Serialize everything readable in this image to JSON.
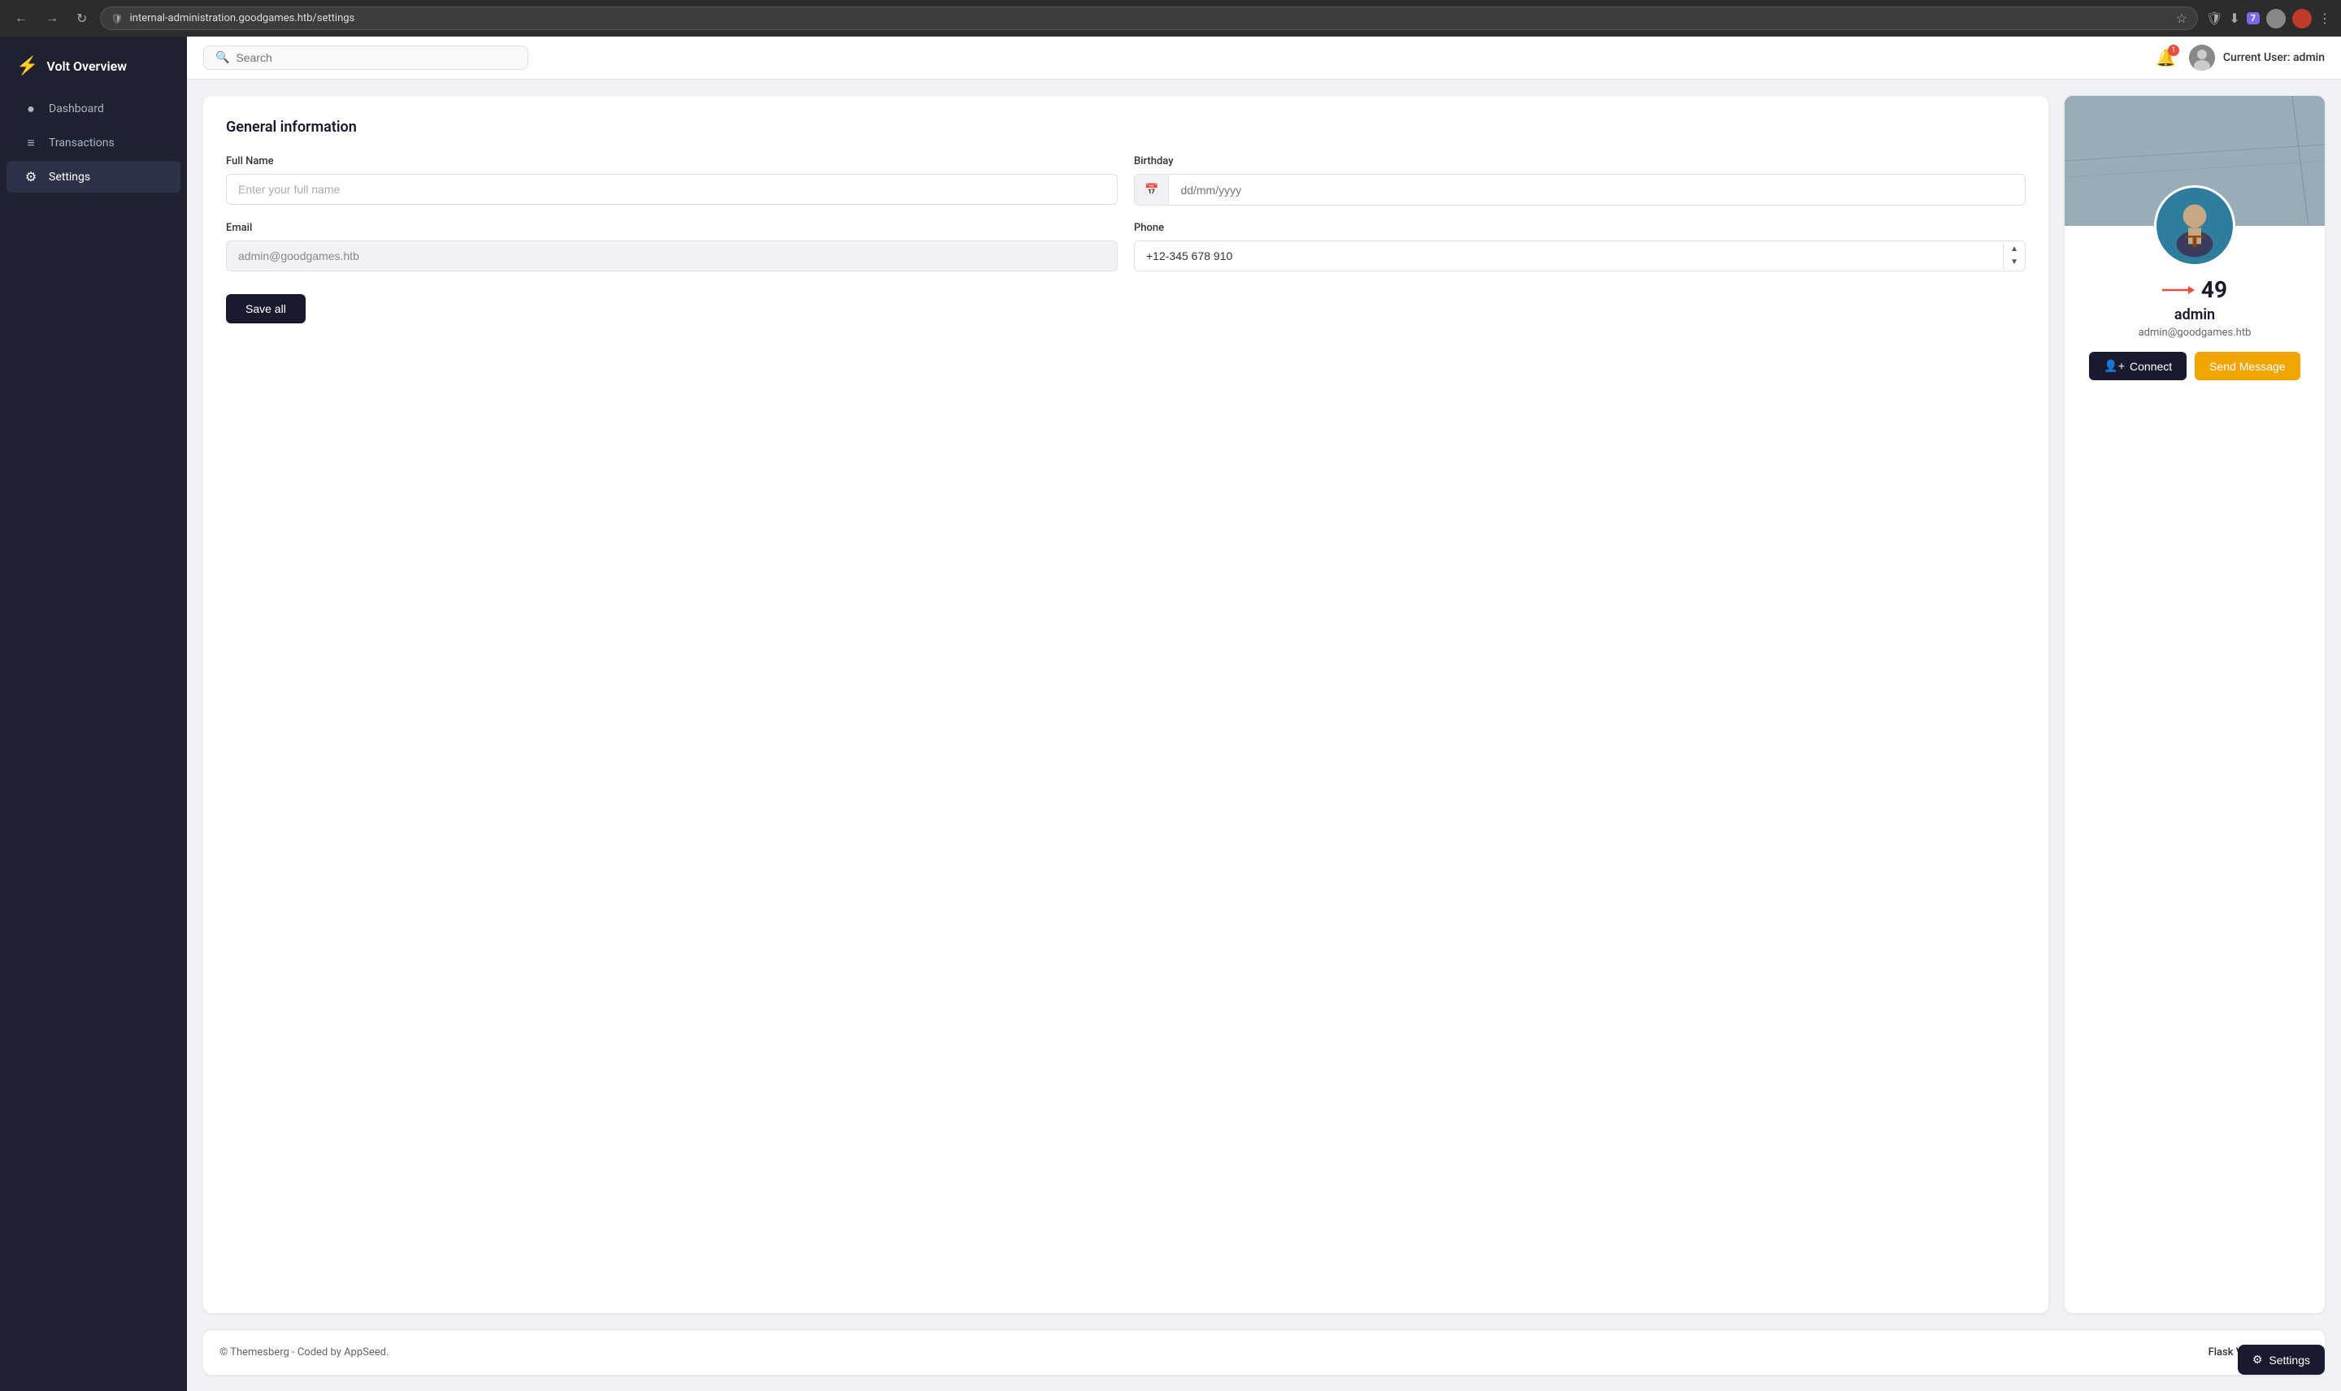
{
  "browser": {
    "url": "internal-administration.goodgames.htb/settings",
    "nav": {
      "back": "←",
      "forward": "→",
      "refresh": "↻"
    }
  },
  "sidebar": {
    "brand": {
      "icon": "⚡",
      "label": "Volt Overview"
    },
    "items": [
      {
        "id": "dashboard",
        "icon": "◕",
        "label": "Dashboard",
        "active": false
      },
      {
        "id": "transactions",
        "icon": "≡",
        "label": "Transactions",
        "active": false
      },
      {
        "id": "settings",
        "icon": "⚙",
        "label": "Settings",
        "active": true
      }
    ]
  },
  "topbar": {
    "search": {
      "placeholder": "Search"
    },
    "user": {
      "label": "Current User: admin"
    }
  },
  "settings_card": {
    "title": "General information",
    "fields": {
      "full_name": {
        "label": "Full Name",
        "placeholder": "Enter your full name",
        "value": ""
      },
      "birthday": {
        "label": "Birthday",
        "placeholder": "dd/mm/yyyy",
        "value": ""
      },
      "email": {
        "label": "Email",
        "value": "admin@goodgames.htb",
        "placeholder": "admin@goodgames.htb"
      },
      "phone": {
        "label": "Phone",
        "value": "+12-345 678 910"
      }
    },
    "save_button": "Save all"
  },
  "profile_card": {
    "score": "49",
    "username": "admin",
    "email": "admin@goodgames.htb",
    "connect_button": "Connect",
    "message_button": "Send Message"
  },
  "footer": {
    "copyright": "© Themesberg - Coded by AppSeed.",
    "brand": "Flask Volt Dashboard"
  },
  "floating_button": {
    "label": "Settings",
    "icon": "⚙"
  }
}
